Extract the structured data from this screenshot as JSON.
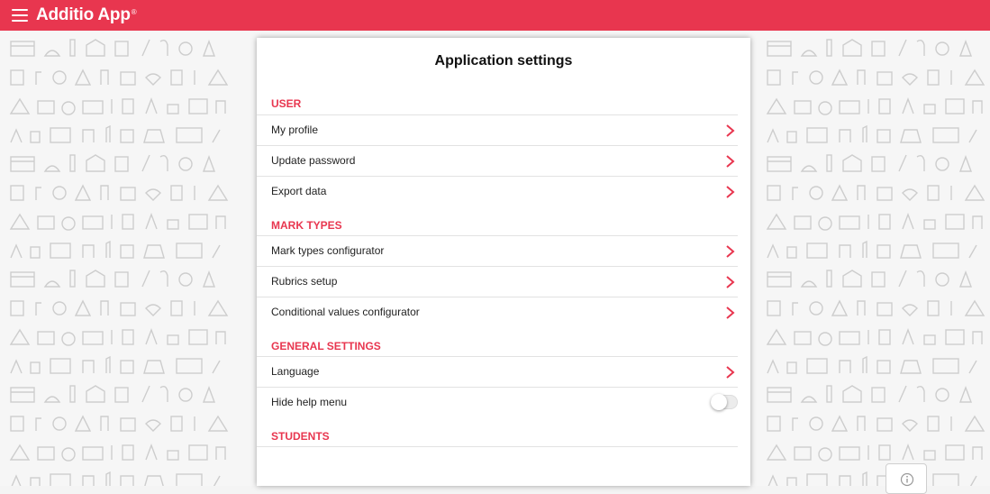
{
  "app": {
    "brand": "Additio App",
    "trademark": "®"
  },
  "topbar": {
    "menu_icon": "hamburger-menu-icon",
    "color": "#e8364f"
  },
  "settings": {
    "title": "Application settings",
    "sections": [
      {
        "heading": "USER",
        "items": [
          {
            "label": "My profile",
            "type": "link"
          },
          {
            "label": "Update password",
            "type": "link"
          },
          {
            "label": "Export data",
            "type": "link"
          }
        ]
      },
      {
        "heading": "MARK TYPES",
        "items": [
          {
            "label": "Mark types configurator",
            "type": "link"
          },
          {
            "label": "Rubrics setup",
            "type": "link"
          },
          {
            "label": "Conditional values configurator",
            "type": "link"
          }
        ]
      },
      {
        "heading": "GENERAL SETTINGS",
        "items": [
          {
            "label": "Language",
            "type": "link"
          },
          {
            "label": "Hide help menu",
            "type": "toggle",
            "value": false
          }
        ]
      },
      {
        "heading": "STUDENTS",
        "items": []
      }
    ]
  },
  "info_button": {
    "icon": "info-icon"
  },
  "colors": {
    "accent": "#e8364f",
    "chevron": "#e8364f",
    "pattern": "#c9c9c9"
  }
}
